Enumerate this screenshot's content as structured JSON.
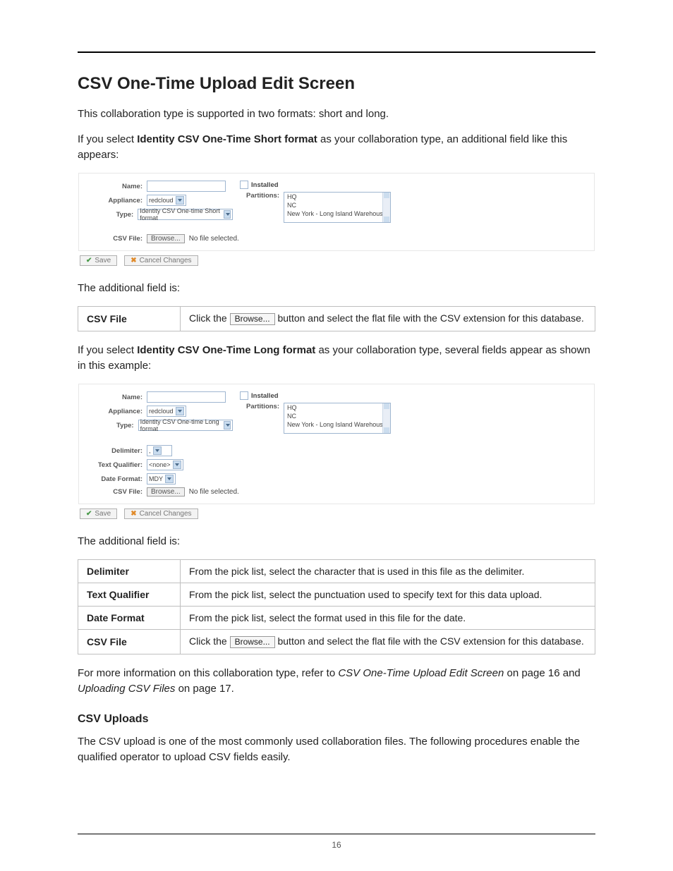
{
  "page_number": "16",
  "heading": "CSV One-Time Upload Edit Screen",
  "para1": "This collaboration type is supported in two formats: short and long.",
  "para2_a": "If you select ",
  "para2_b": "Identity CSV One-Time Short format",
  "para2_c": " as your collaboration type, an additional field like this appears:",
  "para3": "The additional field is:",
  "para4_a": "If you select ",
  "para4_b": "Identity CSV One-Time Long format",
  "para4_c": " as your collaboration type, several fields appear as shown in this example:",
  "para5": "The additional field is:",
  "para6_a": "For more information on this collaboration type, refer to ",
  "para6_b": "CSV One-Time Upload Edit Screen",
  "para6_c": " on page 16 and ",
  "para6_d": "Uploading CSV Files",
  "para6_e": " on page 17.",
  "sub_heading": "CSV Uploads",
  "para7": "The CSV upload is one of the most commonly used collaboration files. The following procedures enable the qualified operator to upload CSV fields easily.",
  "shot_labels": {
    "name": "Name:",
    "appliance": "Appliance:",
    "type": "Type:",
    "installed": "Installed",
    "partitions": "Partitions:",
    "csv_file": "CSV File:",
    "delimiter": "Delimiter:",
    "text_qualifier": "Text Qualifier:",
    "date_format": "Date Format:",
    "browse": "Browse...",
    "no_file": "No file selected.",
    "save": "Save",
    "cancel": "Cancel Changes"
  },
  "shot_values": {
    "appliance": "redcloud",
    "type_short": "Identity CSV One-time Short format",
    "type_long": "Identity CSV One-time Long format",
    "text_qualifier": "<none>",
    "date_format": "MDY",
    "partitions": [
      "HQ",
      "NC",
      "New York - Long Island Warehouse"
    ]
  },
  "table1": {
    "rows": [
      {
        "key": "CSV File",
        "pre": "Click the ",
        "btn": "Browse...",
        "post": " button and select the flat file with the CSV extension for this database."
      }
    ]
  },
  "table2": {
    "rows": [
      {
        "key": "Delimiter",
        "text": "From the pick list, select the character that is used in this file as the delimiter."
      },
      {
        "key": "Text Qualifier",
        "text": "From the pick list, select the punctuation used to specify text for this data upload."
      },
      {
        "key": "Date Format",
        "text": "From the pick list, select the format used in this file for the date."
      },
      {
        "key": "CSV File",
        "pre": "Click the ",
        "btn": "Browse...",
        "post": " button and select the flat file with the CSV extension for this database."
      }
    ]
  }
}
